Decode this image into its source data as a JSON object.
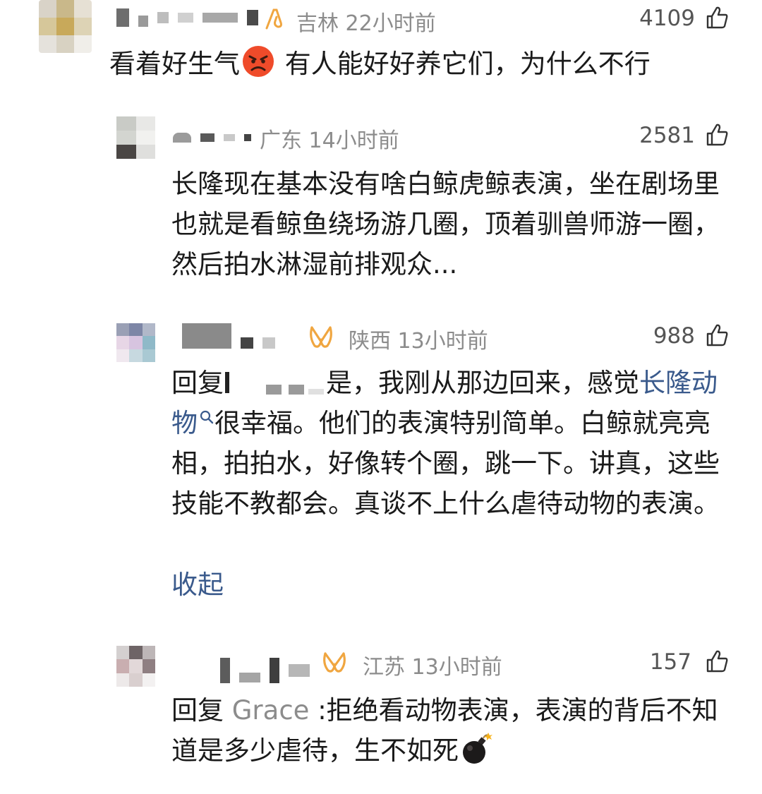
{
  "comments": [
    {
      "region": "吉林",
      "time": "22小时前",
      "likes": "4109",
      "text_before_emoji": "看着好生气",
      "emoji": "angry-face",
      "text_after_emoji": " 有人能好好养它们，为什么不行"
    },
    {
      "region": "广东",
      "time": "14小时前",
      "likes": "2581",
      "text": "长隆现在基本没有啥白鲸虎鲸表演，坐在剧场里也就是看鲸鱼绕场游几圈，顶着驯兽师游一圈，然后拍水淋湿前排观众..."
    },
    {
      "region": "陕西",
      "time": "13小时前",
      "likes": "988",
      "reply_prefix": "回复",
      "text_a": "是，我刚从那边回来，感觉",
      "link_text": "长隆动物",
      "text_b": "很幸福。他们的表演特别简单。白鲸就亮亮相，拍拍水，好像转个圈，跳一下。讲真，这些技能不教都会。真谈不上什么虐待动物的表演。",
      "collapse": "收起"
    },
    {
      "region": "江苏",
      "time": "13小时前",
      "likes": "157",
      "reply_prefix": "回复",
      "reply_to": "Grace",
      "text": ":拒绝看动物表演，表演的背后不知道是多少虐待，生不如死",
      "emoji": "bomb"
    }
  ],
  "colors": {
    "meta": "#8c8c8c",
    "link": "#3a5a8c",
    "vip_badge": "#f0a640"
  }
}
